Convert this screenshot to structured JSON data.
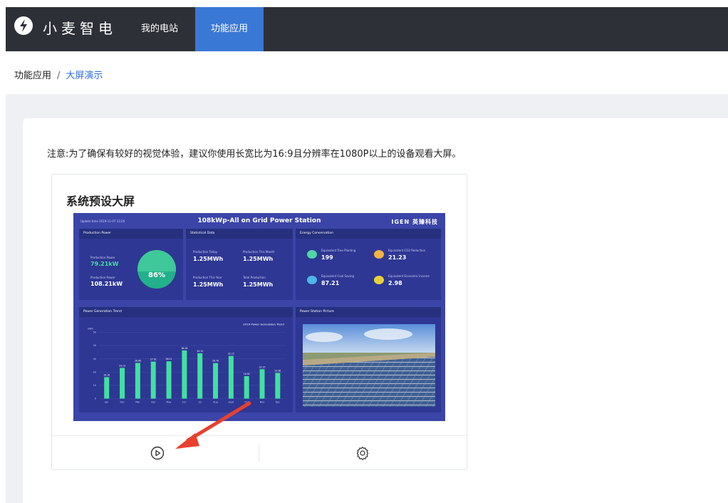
{
  "header": {
    "brand": "小麦智电",
    "nav": [
      {
        "label": "我的电站",
        "active": false
      },
      {
        "label": "功能应用",
        "active": true
      }
    ]
  },
  "breadcrumb": {
    "parent": "功能应用",
    "separator": "/",
    "current": "大屏演示"
  },
  "notice": "注意:为了确保有较好的视觉体验，建议你使用长宽比为16:9且分辨率在1080P以上的设备观看大屏。",
  "card": {
    "title": "系统预设大屏",
    "actions": [
      {
        "name": "play",
        "icon": "play-circle-icon"
      },
      {
        "name": "settings",
        "icon": "gear-icon"
      }
    ]
  },
  "preview": {
    "updated": "Update time 2019-11-07 13:26",
    "title": "108kWp-All on Grid Power Station",
    "brand": "IGEN 英臻科技",
    "production": {
      "heading": "Production Power",
      "label1": "Production Power",
      "value1": "79.21kW",
      "label2": "Production Power",
      "value2": "108.21kW",
      "percent": "86%"
    },
    "statistical": {
      "heading": "Statistical Data",
      "items": [
        {
          "label": "Production Today",
          "value": "1.25MWh"
        },
        {
          "label": "Production This Month",
          "value": "1.25MWh"
        },
        {
          "label": "Production This Year",
          "value": "1.25MWh"
        },
        {
          "label": "Total Production",
          "value": "1.25MWh"
        }
      ]
    },
    "energy": {
      "heading": "Energy Conservation",
      "items": [
        {
          "label": "Equivalent Tree Planting",
          "value": "199"
        },
        {
          "label": "Equivalent CO2 Reduction",
          "value": "21.23"
        },
        {
          "label": "Equivalent Coal Saving",
          "value": "87.21"
        },
        {
          "label": "Equivalent Economic Income",
          "value": "2.98"
        }
      ]
    },
    "trend": {
      "heading": "Power Generation Trend"
    },
    "picture": {
      "heading": "Power Station Picture"
    }
  },
  "chart_data": {
    "type": "bar",
    "title": "2019 Power Generation Trend",
    "ylabel": "kWh",
    "categories": [
      "Jan",
      "Feb",
      "Mar",
      "Apr",
      "May",
      "Jun",
      "Jul",
      "Aug",
      "Sept",
      "Oct",
      "Nov",
      "Dec"
    ],
    "values": [
      16.18,
      23.13,
      26.86,
      27.91,
      28.11,
      36.28,
      34.15,
      26.76,
      32.15,
      16.94,
      22.15,
      19.36
    ],
    "value_labels": [
      "16.18",
      "23.13",
      "26.86",
      "27.91",
      "28.11",
      "36.28",
      "34.15",
      "26.76",
      "32.15",
      "16.94",
      "22.15",
      "19.36"
    ],
    "yticks": [
      0,
      10,
      20,
      30,
      40,
      50
    ],
    "ylim": [
      0,
      50
    ],
    "colors": {
      "bar": "#41e0a1"
    }
  },
  "colors": {
    "nav_bg": "#2d3036",
    "nav_active": "#3a78d6",
    "link": "#2f6fe0",
    "arrow": "#e8402f",
    "preview_bg": "#3b45a8"
  }
}
